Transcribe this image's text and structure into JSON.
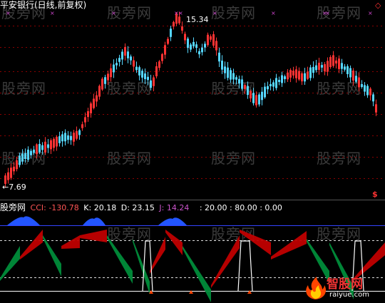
{
  "header": {
    "title": "平安银行(日线,前复权)",
    "diamond_icon": "diamond-outline-icon",
    "title_color": "#ffffff"
  },
  "price_panel": {
    "high_label": "15.34",
    "low_label": "7.69",
    "marker_icon": "dollar-marker-icon",
    "marker_text": "$",
    "marker_color": "#ff3333"
  },
  "indicator": {
    "name": "股旁网",
    "cci_label": "CCI: -130.78",
    "k_label": "K: 20.18",
    "d_label": "D: 23.15",
    "j_label": "J: 14.24",
    "levels_label": ": 20.00 : 80.00 : 0.00",
    "colors": {
      "cci": "#ff5555",
      "k": "#ffffff",
      "d": "#ffffff",
      "j": "#cc55cc",
      "levels": "#ffffff"
    }
  },
  "watermark": {
    "text": "股旁网"
  },
  "brand": {
    "name": "智股网",
    "url": "raiyue.com"
  },
  "colors": {
    "up_candle": "#ff3333",
    "down_candle": "#55d6ff",
    "grid": "#8b0000",
    "cci_line": "#3344ff",
    "band_red": "#c00000",
    "band_green": "#008c3a",
    "blue_area": "#2255ff"
  }
}
